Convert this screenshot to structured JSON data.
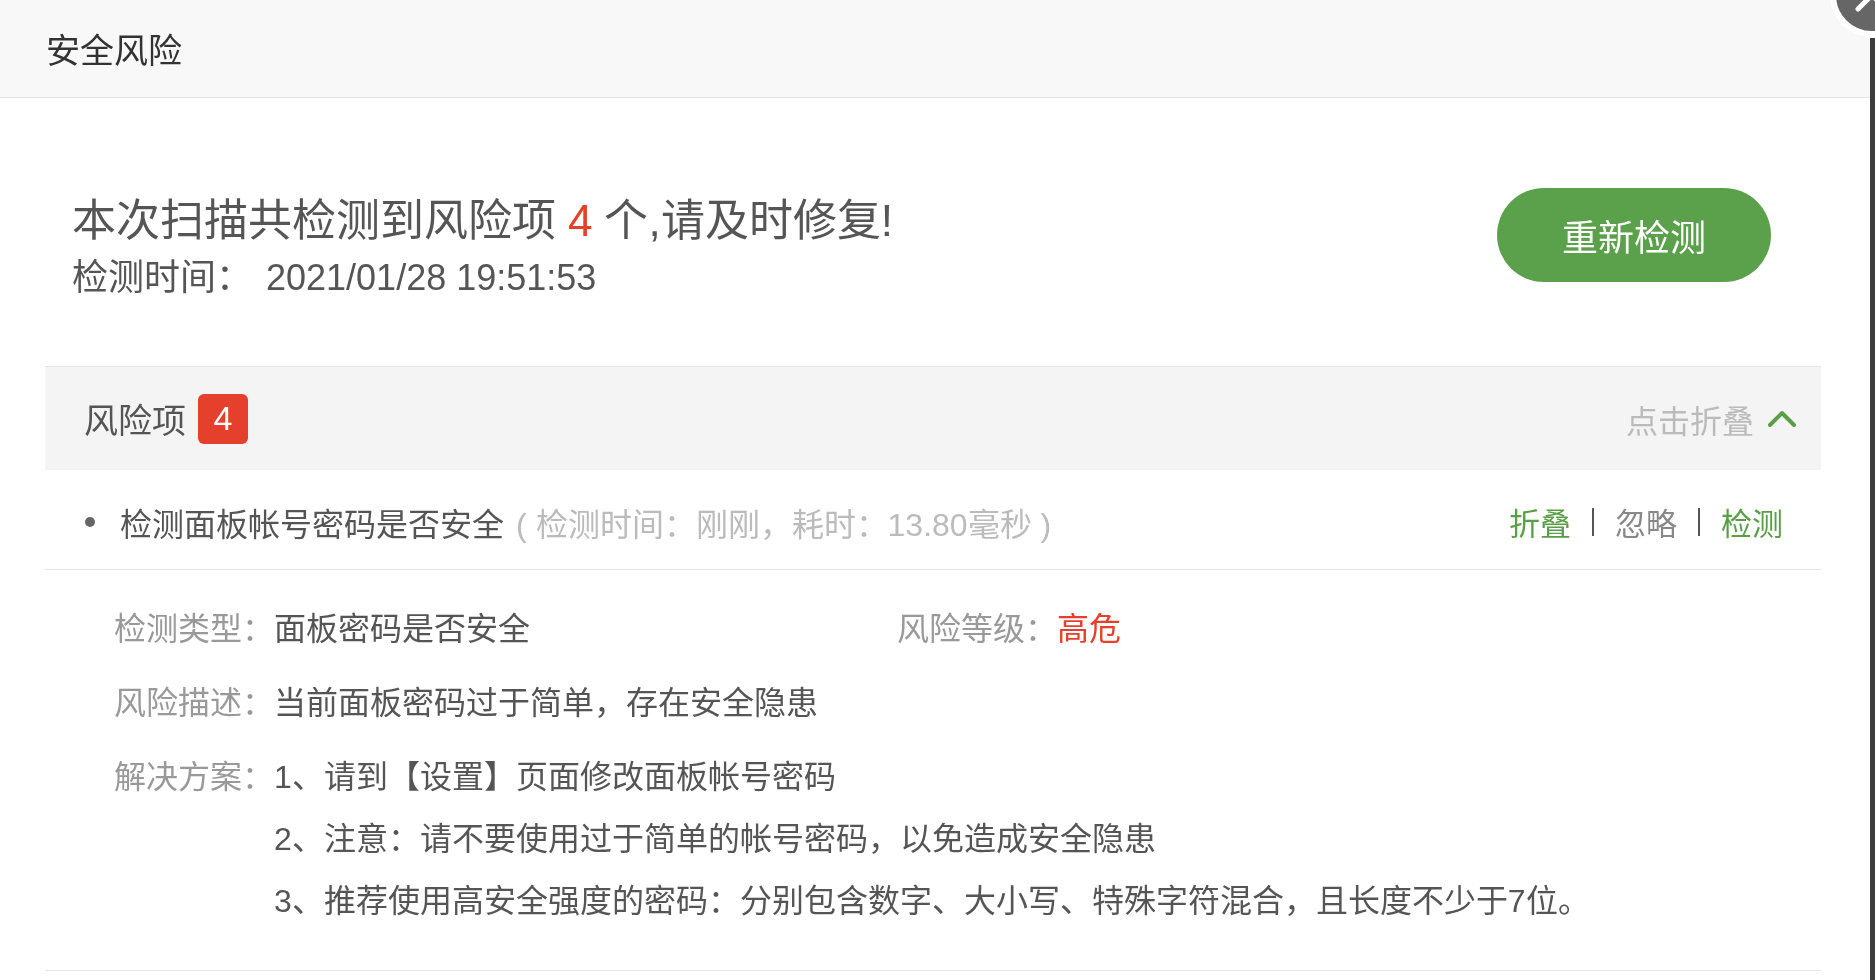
{
  "dialog": {
    "title": "安全风险"
  },
  "summary": {
    "headline_start": "本次扫描共检测到风险项",
    "risk_count": "4",
    "headline_end": "个,请及时修复!",
    "time_label": "检测时间：",
    "time_value": "2021/01/28 19:51:53",
    "rescan_button": "重新检测"
  },
  "risk_section": {
    "title": "风险项",
    "count": "4",
    "toggle_label": "点击折叠",
    "expanded": true,
    "items": [
      {
        "name": "检测面板帐号密码是否安全",
        "meta": "( 检测时间：刚刚，耗时：13.80毫秒 )",
        "actions": [
          {
            "label": "折叠",
            "kind": "primary"
          },
          {
            "label": "忽略",
            "kind": "muted"
          },
          {
            "label": "检测",
            "kind": "primary"
          }
        ],
        "expanded": true,
        "details": {
          "type": {
            "label": "检测类型：",
            "value": "面板密码是否安全"
          },
          "grade": {
            "label": "风险等级：",
            "value": "高危"
          },
          "description": {
            "label": "风险描述：",
            "value": "当前面板密码过于简单，存在安全隐患"
          },
          "solution": {
            "label": "解决方案：",
            "steps": [
              "1、请到【设置】页面修改面板帐号密码",
              "2、注意：请不要使用过于简单的帐号密码，以免造成安全隐患",
              "3、推荐使用高安全强度的密码：分别包含数字、大小写、特殊字符混合，且长度不少于7位。"
            ]
          }
        }
      }
    ]
  }
}
